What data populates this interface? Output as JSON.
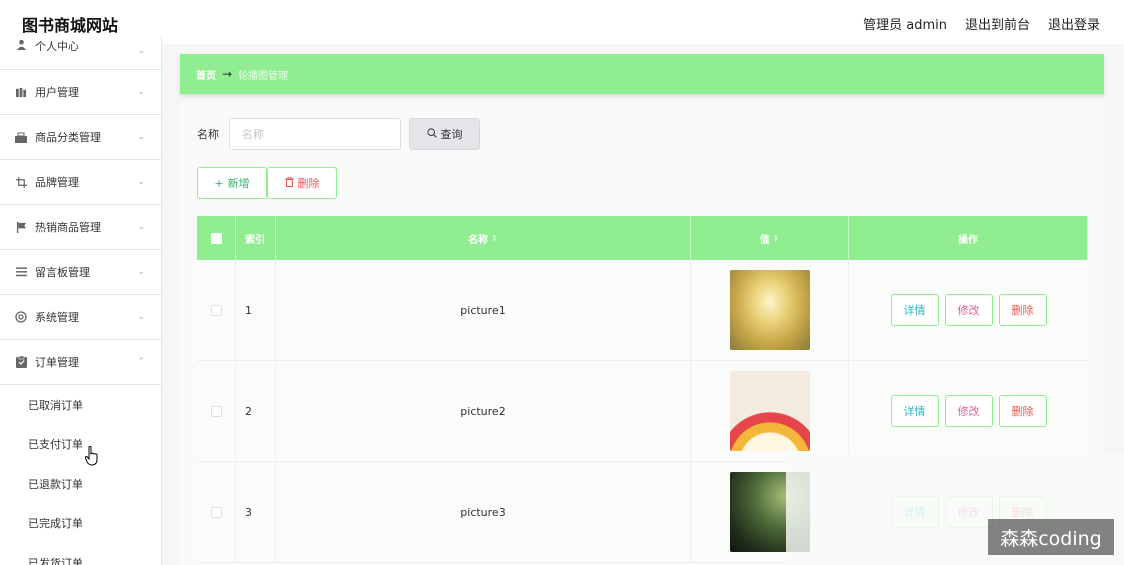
{
  "header": {
    "title": "图书商城网站",
    "admin_label": "管理员 admin",
    "front_label": "退出到前台",
    "logout_label": "退出登录"
  },
  "sidebar": {
    "items": [
      {
        "label": "个人中心",
        "icon": "user-icon"
      },
      {
        "label": "用户管理",
        "icon": "users-icon"
      },
      {
        "label": "商品分类管理",
        "icon": "category-icon"
      },
      {
        "label": "品牌管理",
        "icon": "crop-icon"
      },
      {
        "label": "热销商品管理",
        "icon": "flag-icon"
      },
      {
        "label": "留言板管理",
        "icon": "list-icon"
      },
      {
        "label": "系统管理",
        "icon": "system-icon"
      },
      {
        "label": "订单管理",
        "icon": "order-icon"
      }
    ],
    "sub_items": [
      {
        "label": "已取消订单"
      },
      {
        "label": "已支付订单"
      },
      {
        "label": "已退款订单"
      },
      {
        "label": "已完成订单"
      },
      {
        "label": "已发货订单"
      }
    ]
  },
  "breadcrumb": {
    "home": "首页",
    "current": "轮播图管理"
  },
  "search": {
    "label": "名称",
    "placeholder": "名称",
    "button": "查询"
  },
  "actions": {
    "add": "新增",
    "delete": "删除"
  },
  "table": {
    "headers": {
      "index": "索引",
      "name": "名称",
      "value": "值",
      "operation": "操作"
    },
    "rows": [
      {
        "index": "1",
        "name": "picture1",
        "detail": "详情",
        "edit": "修改",
        "delete": "删除"
      },
      {
        "index": "2",
        "name": "picture2",
        "detail": "详情",
        "edit": "修改",
        "delete": "删除"
      },
      {
        "index": "3",
        "name": "picture3",
        "detail": "详情",
        "edit": "修改",
        "delete": "删除"
      }
    ]
  },
  "watermark": "森森coding",
  "colors": {
    "accent": "#90ee90",
    "detail": "#2fb5c8",
    "edit": "#e0609a",
    "delete": "#ee5555"
  }
}
